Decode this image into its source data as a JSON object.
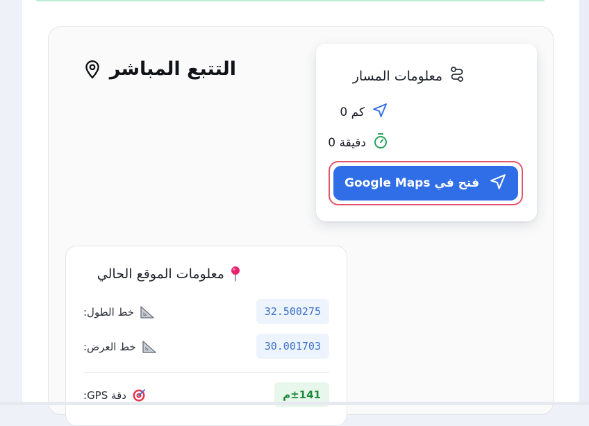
{
  "tracking": {
    "title": "التتبع المباشر",
    "title_icon": "map-pin-outline-icon"
  },
  "route_info": {
    "title": "معلومات المسار",
    "title_icon": "route-icon",
    "distance_text": "كم 0",
    "distance_icon": "navigation-arrow-icon",
    "duration_text": "دقيقة 0",
    "duration_icon": "timer-icon",
    "open_maps_label": "فتح في Google Maps",
    "open_maps_icon": "navigation-arrow-icon"
  },
  "location_info": {
    "title": "معلومات الموقع الحالي",
    "title_icon": "pushpin-icon",
    "longitude_label": "خط الطول:",
    "longitude_value": "32.500275",
    "latitude_label": "خط العرض:",
    "latitude_value": "30.001703",
    "ruler_icon": "triangular-ruler-icon",
    "gps_label": "دقة GPS:",
    "gps_icon": "target-icon",
    "gps_value": "±141م"
  },
  "colors": {
    "accent_blue": "#2f6ee6",
    "focus_ring": "#e2526a",
    "gps_green": "#1f8a3e",
    "coord_blue": "#3a6fc6",
    "timer_green": "#22a35a"
  }
}
